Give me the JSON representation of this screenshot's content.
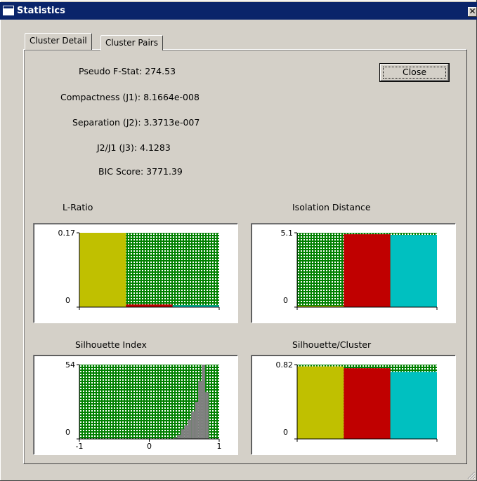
{
  "window": {
    "title": "Statistics",
    "close_glyph": "✕"
  },
  "tabs": [
    {
      "label": "Cluster Detail",
      "active": true
    },
    {
      "label": "Cluster Pairs",
      "active": false
    }
  ],
  "stats": {
    "pseudo_f": "Pseudo F-Stat: 274.53",
    "compactness": "Compactness (J1): 8.1664e-008",
    "separation": "Separation (J2): 3.3713e-007",
    "j3": "J2/J1 (J3): 4.1283",
    "bic": "BIC Score: 3771.39"
  },
  "close_button": {
    "label": "Close"
  },
  "colors": {
    "grid_green": "#008000",
    "yellow": "#c0c000",
    "red": "#c00000",
    "cyan": "#00c0c0",
    "gray": "#808080"
  },
  "chart_data": [
    {
      "id": "l_ratio",
      "type": "bar",
      "title": "L-Ratio",
      "ylim": [
        0,
        0.17
      ],
      "ytick_labels": [
        "0.17",
        "0"
      ],
      "xtick_labels": [],
      "values": [
        0.17,
        0.006,
        0.004
      ],
      "colors": [
        "#c0c000",
        "#c00000",
        "#00c0c0"
      ]
    },
    {
      "id": "isolation_distance",
      "type": "bar",
      "title": "Isolation Distance",
      "ylim": [
        0,
        5.1
      ],
      "ytick_labels": [
        "5.1",
        "0"
      ],
      "xtick_labels": [],
      "values": [
        0.08,
        5.0,
        4.95
      ],
      "colors": [
        "#c0c000",
        "#c00000",
        "#00c0c0"
      ]
    },
    {
      "id": "silhouette_index",
      "type": "bar",
      "title": "Silhouette Index",
      "ylim": [
        0,
        54
      ],
      "ytick_labels": [
        "54",
        "0"
      ],
      "xtick_labels": [
        "-1",
        "0",
        "1"
      ],
      "xlim": [
        -1,
        1
      ],
      "histogram": {
        "bin_edges": [
          0.35,
          0.4,
          0.45,
          0.5,
          0.55,
          0.6,
          0.65,
          0.7,
          0.75,
          0.8,
          0.85
        ],
        "counts": [
          1,
          3,
          7,
          10,
          14,
          20,
          27,
          42,
          54,
          34
        ]
      },
      "colors": [
        "#808080"
      ]
    },
    {
      "id": "silhouette_cluster",
      "type": "bar",
      "title": "Silhouette/Cluster",
      "ylim": [
        0,
        0.82
      ],
      "ytick_labels": [
        "0.82",
        "0"
      ],
      "xtick_labels": [],
      "values": [
        0.8,
        0.78,
        0.74
      ],
      "colors": [
        "#c0c000",
        "#c00000",
        "#00c0c0"
      ]
    }
  ]
}
